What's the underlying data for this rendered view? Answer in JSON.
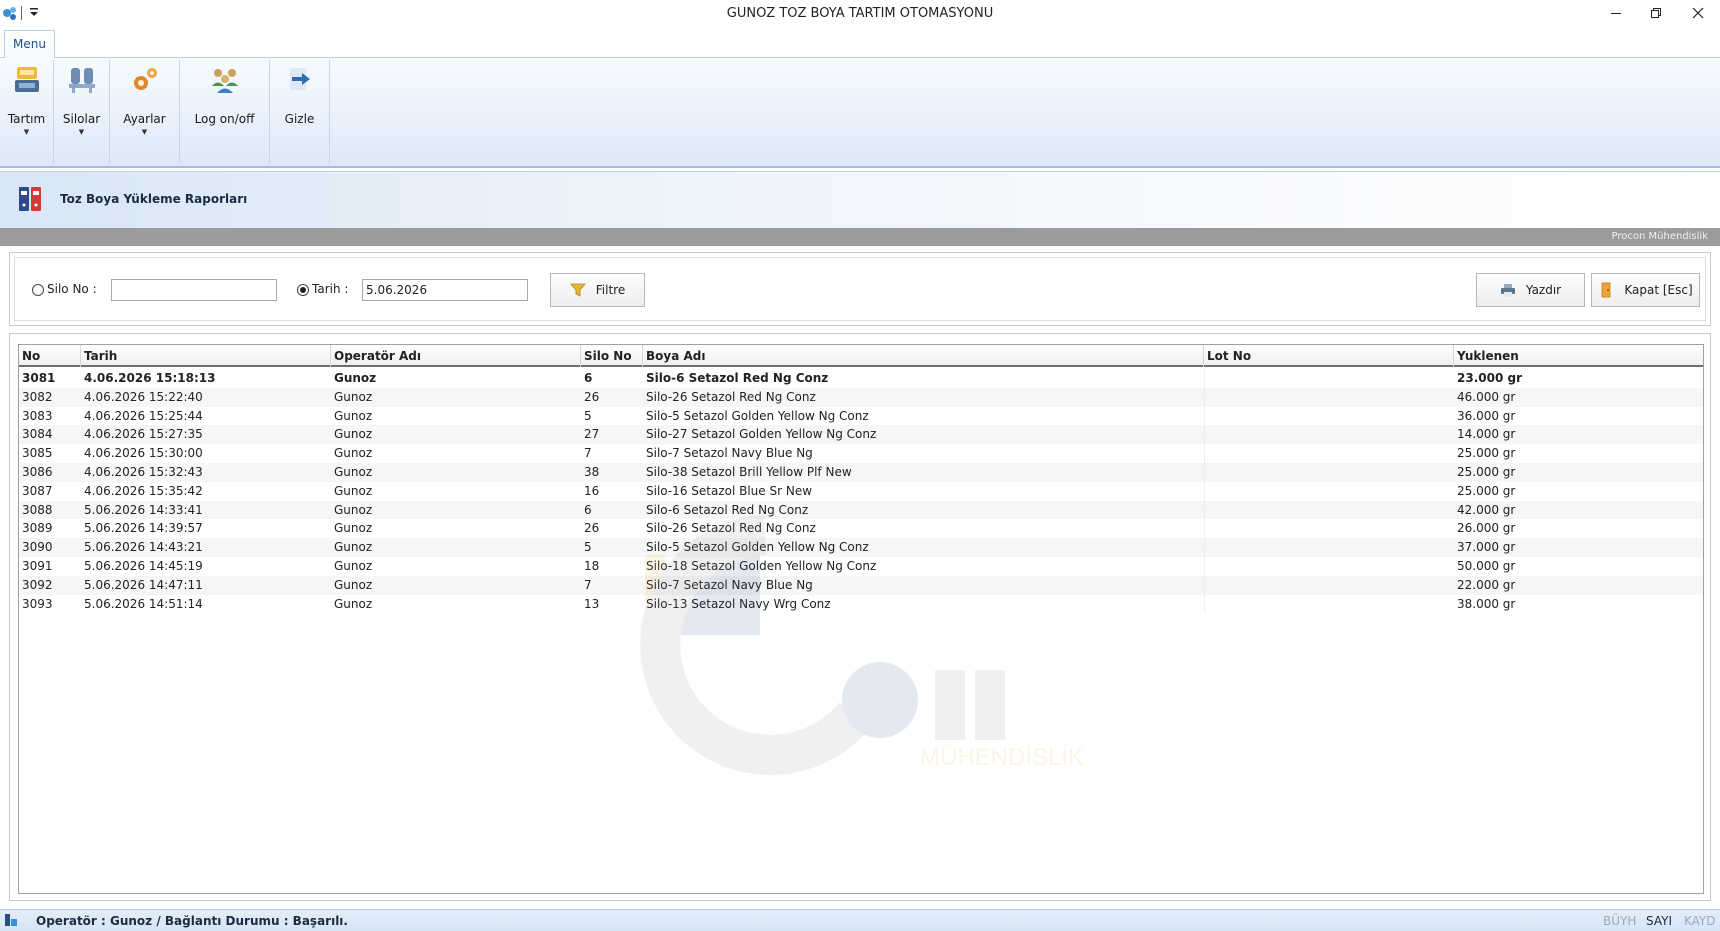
{
  "window": {
    "title": "GUNOZ TOZ BOYA TARTIM OTOMASYONU"
  },
  "ribbon": {
    "tab": "Menu",
    "buttons": [
      {
        "label": "Tartım",
        "icon": "scale-icon",
        "has_dropdown": true
      },
      {
        "label": "Silolar",
        "icon": "silo-icon",
        "has_dropdown": true
      },
      {
        "label": "Ayarlar",
        "icon": "gears-icon",
        "has_dropdown": true
      },
      {
        "label": "Log on/off",
        "icon": "users-icon",
        "has_dropdown": false
      },
      {
        "label": "Gizle",
        "icon": "arrow-right-icon",
        "has_dropdown": false
      }
    ]
  },
  "report": {
    "title": "Toz Boya Yükleme Raporları",
    "brand": "Procon Mühendislik"
  },
  "filter": {
    "silo_label": "Silo No :",
    "silo_value": "",
    "silo_selected": false,
    "date_label": "Tarih :",
    "date_value": "5.06.2026",
    "date_selected": true,
    "filter_button": "Filtre",
    "print_button": "Yazdır",
    "close_button": "Kapat [Esc]"
  },
  "grid": {
    "columns": [
      "No",
      "Tarih",
      "Operatör Adı",
      "Silo No",
      "Boya Adı",
      "Lot No",
      "Yuklenen"
    ],
    "rows": [
      [
        "3081",
        "4.06.2026 15:18:13",
        "Gunoz",
        "6",
        "Silo-6 Setazol Red Ng Conz",
        "",
        "23.000 gr"
      ],
      [
        "3082",
        "4.06.2026 15:22:40",
        "Gunoz",
        "26",
        "Silo-26 Setazol Red Ng Conz",
        "",
        "46.000 gr"
      ],
      [
        "3083",
        "4.06.2026 15:25:44",
        "Gunoz",
        "5",
        "Silo-5 Setazol Golden Yellow Ng Conz",
        "",
        "36.000 gr"
      ],
      [
        "3084",
        "4.06.2026 15:27:35",
        "Gunoz",
        "27",
        "Silo-27 Setazol Golden Yellow Ng Conz",
        "",
        "14.000 gr"
      ],
      [
        "3085",
        "4.06.2026 15:30:00",
        "Gunoz",
        "7",
        "Silo-7 Setazol Navy Blue Ng",
        "",
        "25.000 gr"
      ],
      [
        "3086",
        "4.06.2026 15:32:43",
        "Gunoz",
        "38",
        "Silo-38 Setazol Brill Yellow Plf New",
        "",
        "25.000 gr"
      ],
      [
        "3087",
        "4.06.2026 15:35:42",
        "Gunoz",
        "16",
        "Silo-16 Setazol Blue Sr New",
        "",
        "25.000 gr"
      ],
      [
        "3088",
        "5.06.2026 14:33:41",
        "Gunoz",
        "6",
        "Silo-6 Setazol Red Ng Conz",
        "",
        "42.000 gr"
      ],
      [
        "3089",
        "5.06.2026 14:39:57",
        "Gunoz",
        "26",
        "Silo-26 Setazol Red Ng Conz",
        "",
        "26.000 gr"
      ],
      [
        "3090",
        "5.06.2026 14:43:21",
        "Gunoz",
        "5",
        "Silo-5 Setazol Golden Yellow Ng Conz",
        "",
        "37.000 gr"
      ],
      [
        "3091",
        "5.06.2026 14:45:19",
        "Gunoz",
        "18",
        "Silo-18 Setazol Golden Yellow Ng Conz",
        "",
        "50.000 gr"
      ],
      [
        "3092",
        "5.06.2026 14:47:11",
        "Gunoz",
        "7",
        "Silo-7 Setazol Navy Blue Ng",
        "",
        "22.000 gr"
      ],
      [
        "3093",
        "5.06.2026 14:51:14",
        "Gunoz",
        "13",
        "Silo-13 Setazol Navy Wrg Conz",
        "",
        "38.000 gr"
      ]
    ]
  },
  "watermark": {
    "text": "MÜHENDİSLİK"
  },
  "status": {
    "text": "Operatör :  Gunoz / Bağlantı Durumu :  Başarılı.",
    "caps": "BÜYH",
    "num": "SAYI",
    "scroll": "KAYD"
  },
  "colors": {
    "ribbon": "#e9f1fb",
    "header_line": "#6d6d6d",
    "status_bar": "#d6e4f4",
    "gray_bar": "#9b9b9b"
  }
}
